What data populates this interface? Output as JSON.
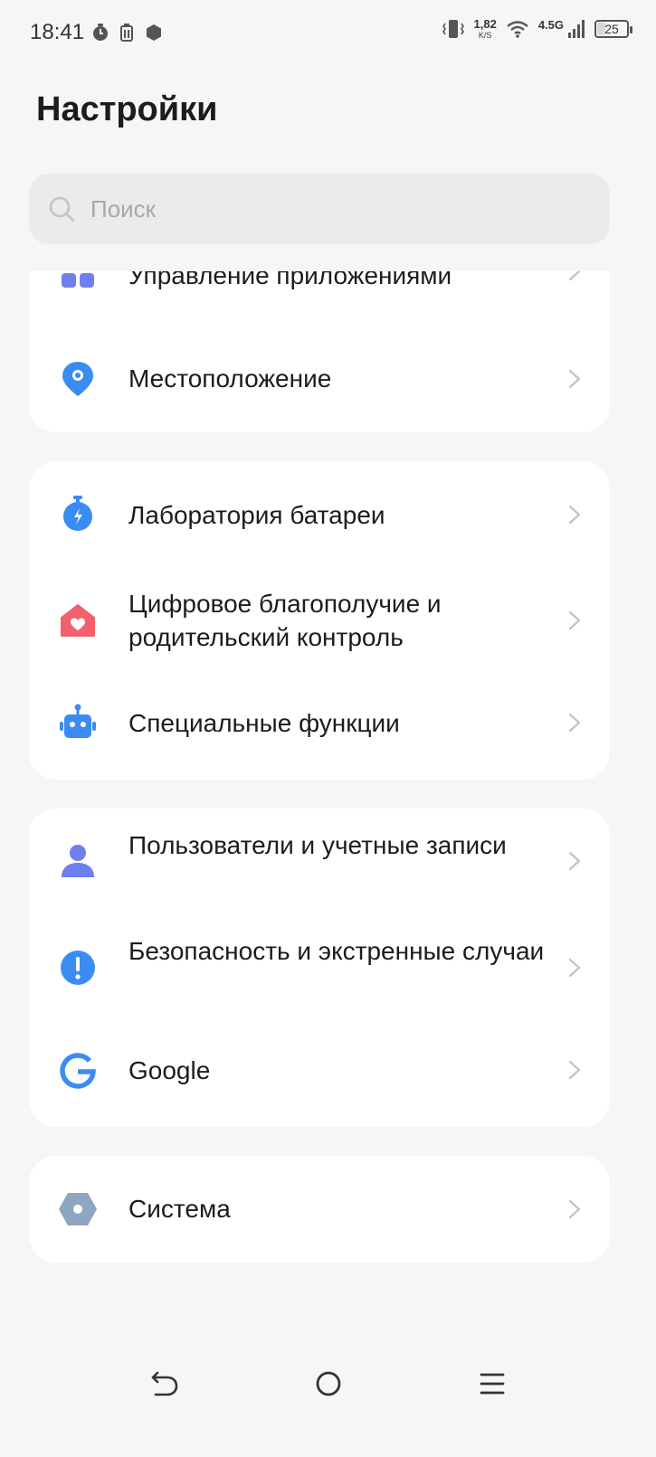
{
  "status_bar": {
    "time": "18:41",
    "speed_value": "1,82",
    "speed_unit": "K/S",
    "network": "4.5G",
    "battery": "25",
    "battery_level": 0.25
  },
  "page": {
    "title": "Настройки"
  },
  "search": {
    "placeholder": "Поиск"
  },
  "groups": [
    {
      "items": [
        {
          "label": "Управление приложениями",
          "icon": "app-grid-icon"
        },
        {
          "label": "Местоположение",
          "icon": "location-pin-icon"
        }
      ]
    },
    {
      "items": [
        {
          "label": "Лаборатория батареи",
          "icon": "battery-lab-icon"
        },
        {
          "label": "Цифровое благополучие и родительский контроль",
          "icon": "digital-wellbeing-icon"
        },
        {
          "label": "Специальные функции",
          "icon": "accessibility-robot-icon"
        }
      ]
    },
    {
      "items": [
        {
          "label": "Пользователи и учетные записи",
          "icon": "user-icon"
        },
        {
          "label": "Безопасность и экстренные случаи",
          "icon": "emergency-icon"
        },
        {
          "label": "Google",
          "icon": "google-icon"
        }
      ]
    },
    {
      "items": [
        {
          "label": "Система",
          "icon": "system-hexagon-icon"
        }
      ]
    }
  ],
  "colors": {
    "background": "#f6f6f6",
    "card": "#ffffff",
    "blue": "#3b8cf2",
    "red": "#f2616b",
    "purple": "#6f7ff0",
    "slate": "#8fa6c2"
  }
}
